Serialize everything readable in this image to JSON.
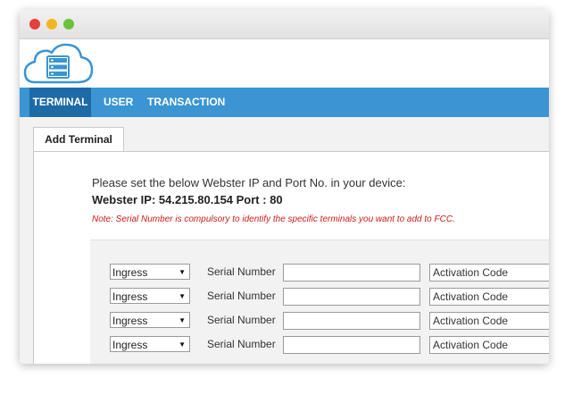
{
  "window_controls": {
    "close_color": "#e5403c",
    "minimize_color": "#f3b51f",
    "maximize_color": "#6cc33a"
  },
  "logo": {
    "icon": "cloud-server-icon",
    "color": "#3a95d2"
  },
  "nav": {
    "items": [
      {
        "label": "TERMINAL",
        "active": true
      },
      {
        "label": "USER",
        "active": false
      },
      {
        "label": "TRANSACTION",
        "active": false
      }
    ],
    "bar_color": "#3a95d2",
    "active_color": "#1d6aa6"
  },
  "tab": {
    "label": "Add Terminal"
  },
  "instructions": {
    "line1": "Please set the below Webster IP and Port No. in your device:",
    "line2": "Webster IP: 54.215.80.154 Port : 80",
    "note": "Note: Serial Number is compulsory to identify the specific terminals you want to add to FCC."
  },
  "form": {
    "rows": [
      {
        "direction": "Ingress",
        "serial_label": "Serial Number",
        "serial_value": "",
        "activation_placeholder": "Activation Code"
      },
      {
        "direction": "Ingress",
        "serial_label": "Serial Number",
        "serial_value": "",
        "activation_placeholder": "Activation Code"
      },
      {
        "direction": "Ingress",
        "serial_label": "Serial Number",
        "serial_value": "",
        "activation_placeholder": "Activation Code"
      },
      {
        "direction": "Ingress",
        "serial_label": "Serial Number",
        "serial_value": "",
        "activation_placeholder": "Activation Code"
      }
    ],
    "dropdown_arrow": "▼"
  }
}
